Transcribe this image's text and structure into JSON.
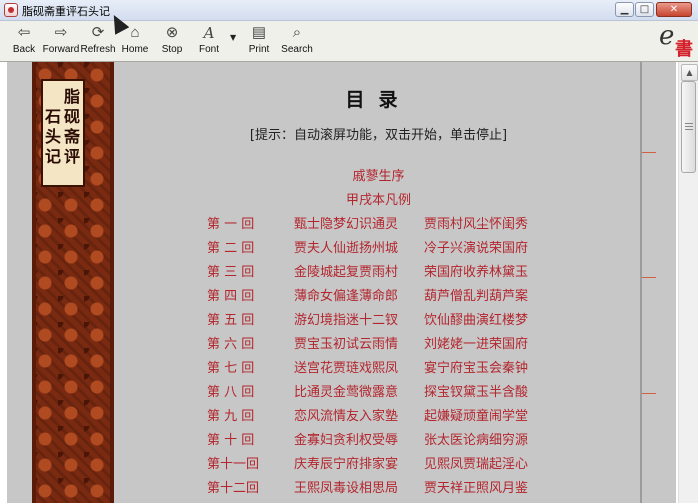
{
  "window": {
    "title": "脂砚斋重评石头记",
    "minimize_glyph": "▁",
    "maximize_glyph": "□",
    "close_glyph": "✕"
  },
  "toolbar": {
    "buttons": [
      {
        "label": "Back",
        "icon": "back-arrow-icon",
        "glyph": "⇦"
      },
      {
        "label": "Forward",
        "icon": "forward-arrow-icon",
        "glyph": "⇨"
      },
      {
        "label": "Refresh",
        "icon": "refresh-icon",
        "glyph": "⟳"
      },
      {
        "label": "Home",
        "icon": "home-icon",
        "glyph": "⌂"
      },
      {
        "label": "Stop",
        "icon": "stop-icon",
        "glyph": "⊗"
      },
      {
        "label": "Font",
        "icon": "font-icon",
        "glyph": "A"
      },
      {
        "label": "Print",
        "icon": "print-icon",
        "glyph": "▤"
      },
      {
        "label": "Search",
        "icon": "search-icon",
        "glyph": "⌕"
      }
    ],
    "font_dropdown_glyph": "▼",
    "logo": {
      "letter": "e",
      "char": "書"
    }
  },
  "book": {
    "seal": {
      "col1": "脂砚斋评",
      "col2": "石头记"
    },
    "heading": "目录",
    "hint": "[提示：自动滚屏功能，双击开始，单击停止]",
    "front_matter": [
      "戚蓼生序",
      "甲戌本凡例"
    ],
    "chapters": [
      {
        "num": "第 一 回",
        "t1": "甄士隐梦幻识通灵",
        "t2": "贾雨村风尘怀闺秀"
      },
      {
        "num": "第 二 回",
        "t1": "贾夫人仙逝扬州城",
        "t2": "冷子兴演说荣国府"
      },
      {
        "num": "第 三 回",
        "t1": "金陵城起复贾雨村",
        "t2": "荣国府收养林黛玉"
      },
      {
        "num": "第 四 回",
        "t1": "薄命女偏逢薄命郎",
        "t2": "葫芦僧乱判葫芦案"
      },
      {
        "num": "第 五 回",
        "t1": "游幻境指迷十二钗",
        "t2": "饮仙醪曲演红楼梦"
      },
      {
        "num": "第 六 回",
        "t1": "贾宝玉初试云雨情",
        "t2": "刘姥姥一进荣国府"
      },
      {
        "num": "第 七 回",
        "t1": "送宫花贾琏戏熙凤",
        "t2": "宴宁府宝玉会秦钟"
      },
      {
        "num": "第 八 回",
        "t1": "比通灵金莺微露意",
        "t2": "探宝钗黛玉半含酸"
      },
      {
        "num": "第 九 回",
        "t1": "恋风流情友入家塾",
        "t2": "起嫌疑顽童闹学堂"
      },
      {
        "num": "第 十 回",
        "t1": "金寡妇贪利权受辱",
        "t2": "张太医论病细穷源"
      },
      {
        "num": "第十一回",
        "t1": "庆寿辰宁府排家宴",
        "t2": "见熙凤贾瑞起淫心"
      },
      {
        "num": "第十二回",
        "t1": "王熙凤毒设相思局",
        "t2": "贾天祥正照风月鉴"
      }
    ]
  },
  "scrollbar": {
    "up_glyph": "▲"
  }
}
